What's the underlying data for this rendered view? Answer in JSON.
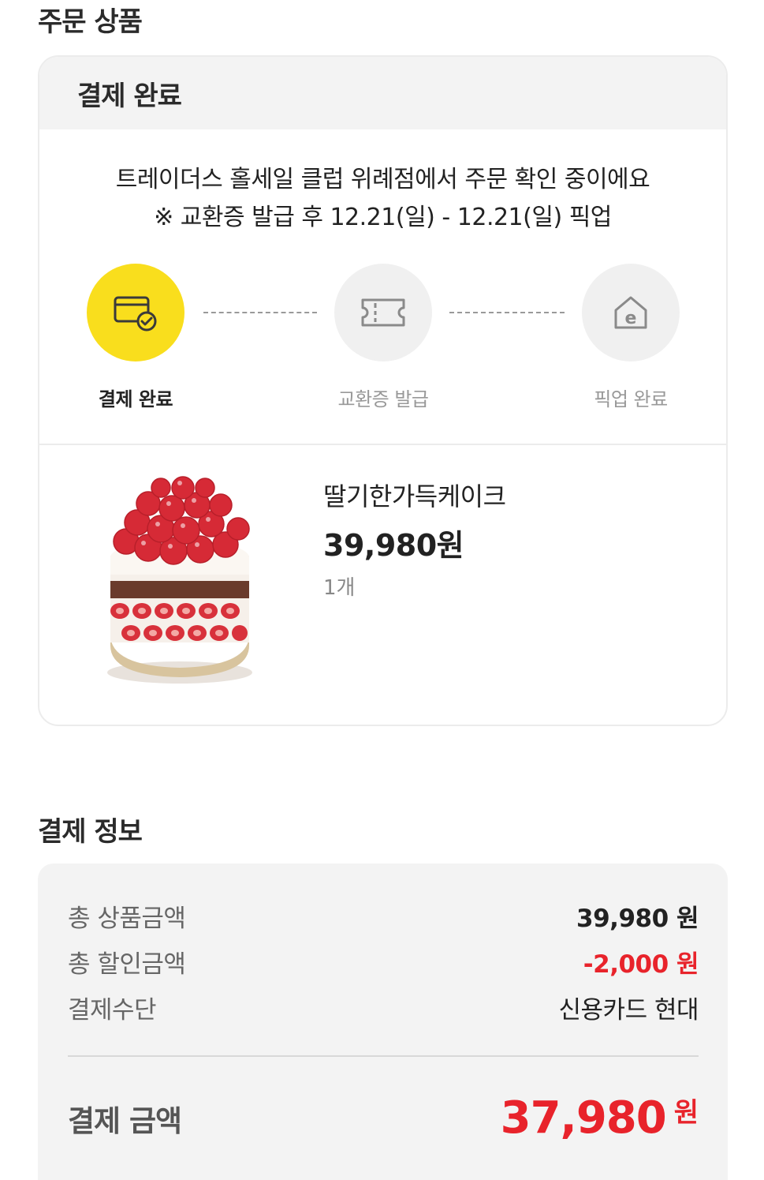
{
  "order_section": {
    "title": "주문 상품"
  },
  "order_card": {
    "status_header": "결제 완료",
    "notice_line1": "트레이더스 홀세일 클럽 위례점에서 주문 확인 중이에요",
    "notice_line2": "※ 교환증 발급 후 12.21(일) - 12.21(일) 픽업",
    "steps": [
      {
        "label": "결제 완료",
        "icon": "card-check-icon",
        "active": true
      },
      {
        "label": "교환증 발급",
        "icon": "ticket-icon",
        "active": false
      },
      {
        "label": "픽업 완료",
        "icon": "emart-home-icon",
        "active": false
      }
    ],
    "product": {
      "name": "딸기한가득케이크",
      "price": "39,980원",
      "quantity": "1개",
      "image": "strawberry-cake-image"
    }
  },
  "payment_section": {
    "title": "결제 정보",
    "rows": [
      {
        "label": "총 상품금액",
        "value": "39,980 원"
      },
      {
        "label": "총 할인금액",
        "value": "-2,000 원"
      },
      {
        "label": "결제수단",
        "value": "신용카드 현대"
      }
    ],
    "total_label": "결제 금액",
    "total_value": "37,980",
    "total_unit": "원"
  },
  "colors": {
    "accent_yellow": "#f9de1d",
    "discount_red": "#e8232b",
    "panel_gray": "#f3f3f3"
  }
}
